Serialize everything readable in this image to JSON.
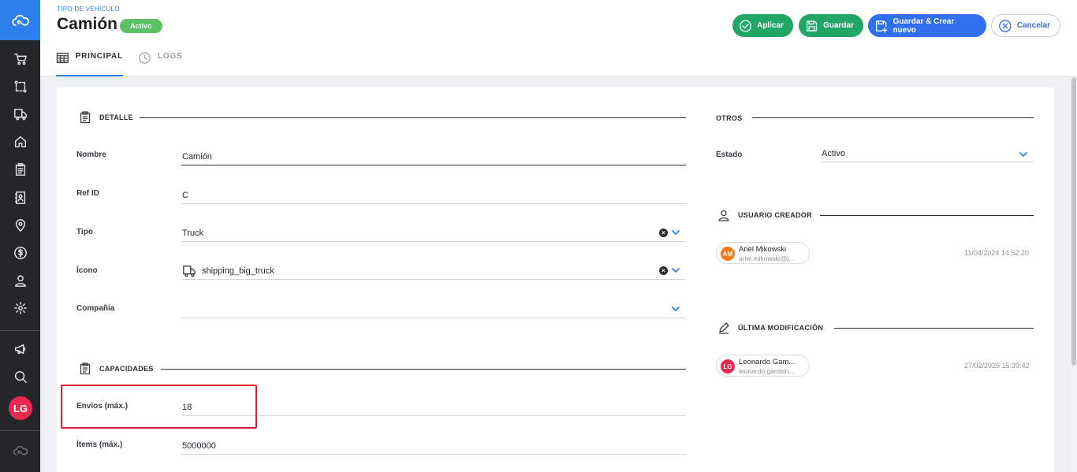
{
  "colors": {
    "accent": "#2f80ed",
    "sidebar": "#24262a",
    "success": "#21a666",
    "badge": "#5cc164",
    "primary_button": "#2f6ff0",
    "highlight": "#e01b2a"
  },
  "sidebar": {
    "logo_icon": "cloud-logo-icon",
    "items": [
      {
        "icon": "cart-icon"
      },
      {
        "icon": "route-icon"
      },
      {
        "icon": "truck-icon"
      },
      {
        "icon": "home-icon"
      },
      {
        "icon": "clipboard-icon"
      },
      {
        "icon": "contact-book-icon"
      },
      {
        "icon": "location-pin-icon"
      },
      {
        "icon": "dollar-icon"
      },
      {
        "icon": "user-icon"
      },
      {
        "icon": "gear-icon"
      }
    ],
    "bottom_items": [
      {
        "icon": "megaphone-icon"
      },
      {
        "icon": "search-icon"
      }
    ],
    "avatar_initials": "LG"
  },
  "header": {
    "eyebrow": "TIPO DE VEHÍCULO",
    "title": "Camión",
    "status_badge": "Activo",
    "buttons": {
      "apply": "Aplicar",
      "save": "Guardar",
      "save_new": "Guardar & Crear nuevo",
      "cancel": "Cancelar"
    },
    "tabs": [
      {
        "label": "PRINCIPAL",
        "icon": "table-icon",
        "active": true
      },
      {
        "label": "LOGS",
        "icon": "clock-icon",
        "active": false
      }
    ]
  },
  "detalle": {
    "heading": "DETALLE",
    "fields": {
      "nombre": {
        "label": "Nombre",
        "value": "Camión"
      },
      "ref_id": {
        "label": "Ref ID",
        "value": "C"
      },
      "tipo": {
        "label": "Tipo",
        "value": "Truck"
      },
      "icono": {
        "label": "Ícono",
        "value": "shipping_big_truck"
      },
      "compania": {
        "label": "Compañía",
        "value": ""
      }
    }
  },
  "capacidades": {
    "heading": "CAPACIDADES",
    "fields": {
      "envios": {
        "label": "Envíos (máx.)",
        "value": "18"
      },
      "items": {
        "label": "Ítems (máx.)",
        "value": "5000000"
      }
    }
  },
  "otros": {
    "heading": "OTROS",
    "estado": {
      "label": "Estado",
      "value": "Activo"
    },
    "creator": {
      "heading": "USUARIO CREADOR",
      "initials": "AM",
      "name": "Ariel Mikowski",
      "email": "ariel.mikowski@j...",
      "timestamp": "11/04/2024 14:52:20"
    },
    "last_modified": {
      "heading": "ÚLTIMA MODIFICACIÓN",
      "initials": "LG",
      "name": "Leonardo Gam...",
      "email": "leonardo.gambin...",
      "timestamp": "27/02/2025 15:39:42"
    }
  }
}
